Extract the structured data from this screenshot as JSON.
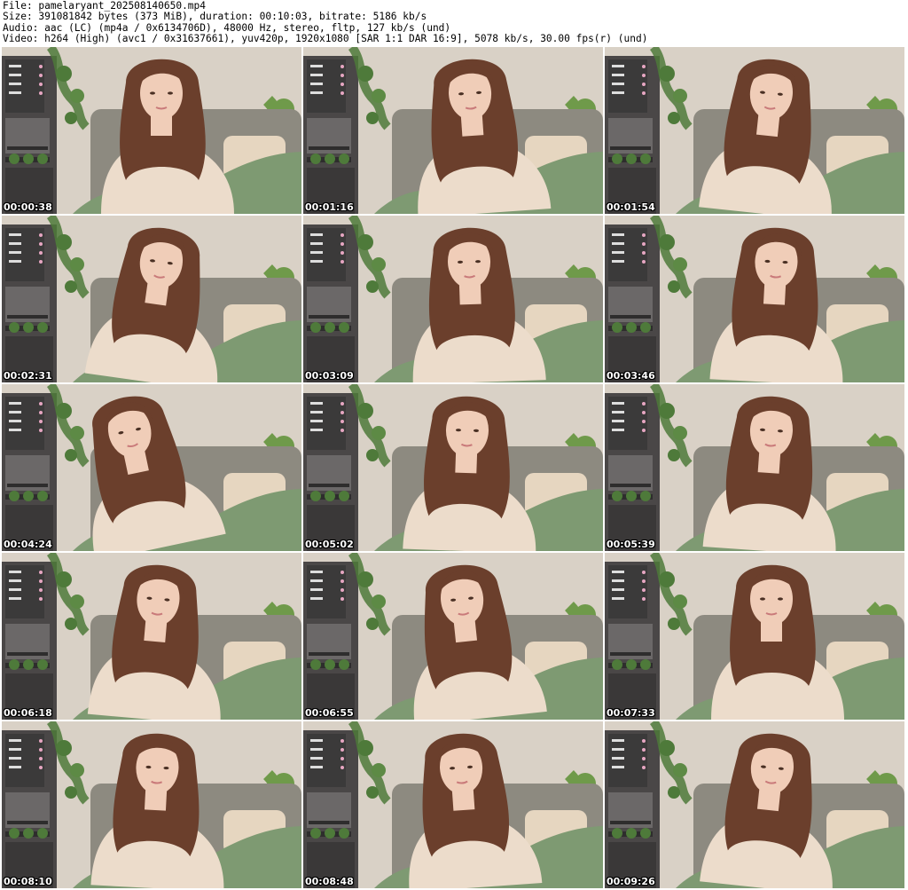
{
  "header": {
    "line1": "File: pamelaryant_202508140650.mp4",
    "line2": "Size: 391081842 bytes (373 MiB), duration: 00:10:03, bitrate: 5186 kb/s",
    "line3": "Audio: aac (LC) (mp4a / 0x6134706D), 48000 Hz, stereo, fltp, 127 kb/s (und)",
    "line4": "Video: h264 (High) (avc1 / 0x31637661), yuv420p, 1920x1080 [SAR 1:1 DAR 16:9], 5078 kb/s, 30.00 fps(r) (und)"
  },
  "thumbnails": [
    {
      "timestamp": "00:00:38"
    },
    {
      "timestamp": "00:01:16"
    },
    {
      "timestamp": "00:01:54"
    },
    {
      "timestamp": "00:02:31"
    },
    {
      "timestamp": "00:03:09"
    },
    {
      "timestamp": "00:03:46"
    },
    {
      "timestamp": "00:04:24"
    },
    {
      "timestamp": "00:05:02"
    },
    {
      "timestamp": "00:05:39"
    },
    {
      "timestamp": "00:06:18"
    },
    {
      "timestamp": "00:06:55"
    },
    {
      "timestamp": "00:07:33"
    },
    {
      "timestamp": "00:08:10"
    },
    {
      "timestamp": "00:08:48"
    },
    {
      "timestamp": "00:09:26"
    }
  ],
  "colors": {
    "page_background": "#ffffff",
    "wall": "#d9d1c6",
    "sofa": "#8d8a80",
    "blanket": "#7e9a72",
    "sweater": "#ecdccb",
    "hair": "#6b3f2c",
    "skin": "#f0cdb8",
    "shelf": "#3b3a3a",
    "plant": "#4e7a3a"
  }
}
